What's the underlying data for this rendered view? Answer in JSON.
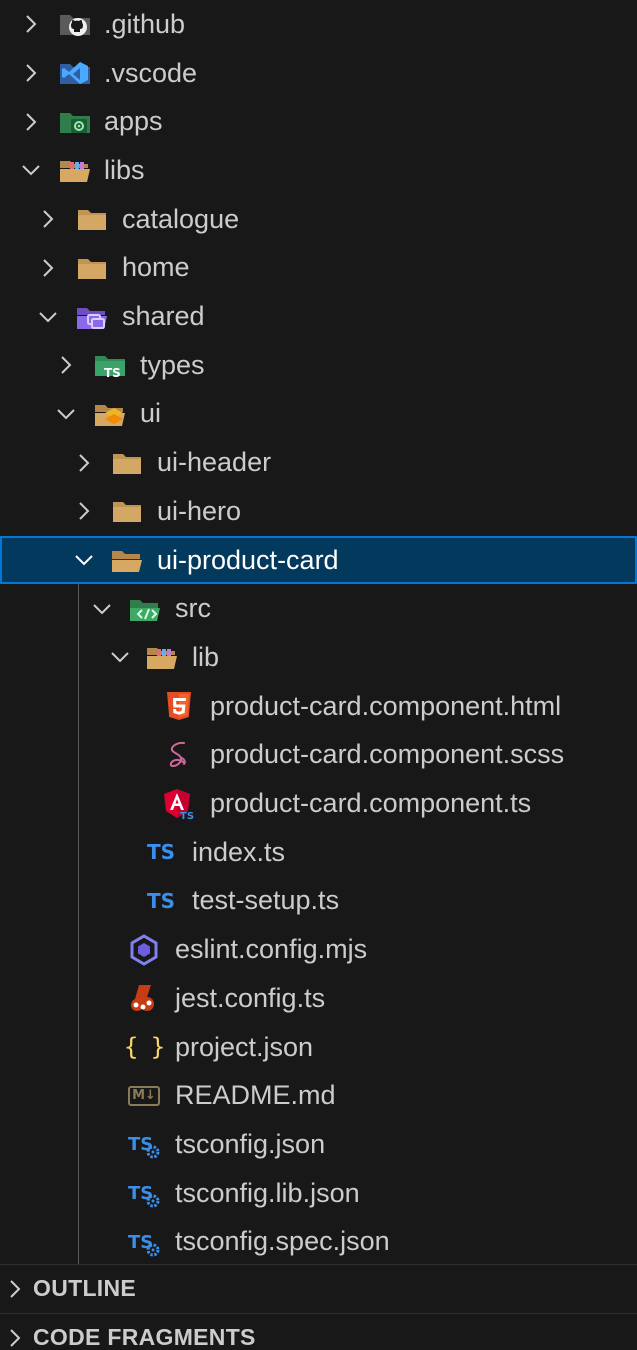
{
  "explorer": {
    "items": [
      {
        "label": ".github",
        "icon": "github-folder-icon",
        "expanded": false
      },
      {
        "label": ".vscode",
        "icon": "vscode-folder-icon",
        "expanded": false
      },
      {
        "label": "apps",
        "icon": "apps-folder-icon",
        "expanded": false
      },
      {
        "label": "libs",
        "icon": "libs-folder-open-icon",
        "expanded": true
      },
      {
        "label": "catalogue",
        "icon": "folder-icon",
        "expanded": false
      },
      {
        "label": "home",
        "icon": "folder-icon",
        "expanded": false
      },
      {
        "label": "shared",
        "icon": "shared-folder-open-icon",
        "expanded": true
      },
      {
        "label": "types",
        "icon": "typescript-folder-icon",
        "expanded": false
      },
      {
        "label": "ui",
        "icon": "ui-folder-open-icon",
        "expanded": true
      },
      {
        "label": "ui-header",
        "icon": "folder-icon",
        "expanded": false
      },
      {
        "label": "ui-hero",
        "icon": "folder-icon",
        "expanded": false
      },
      {
        "label": "ui-product-card",
        "icon": "folder-open-icon",
        "expanded": true,
        "selected": true
      },
      {
        "label": "src",
        "icon": "src-folder-open-icon",
        "expanded": true
      },
      {
        "label": "lib",
        "icon": "lib-folder-open-icon",
        "expanded": true
      },
      {
        "label": "product-card.component.html",
        "icon": "html5-icon"
      },
      {
        "label": "product-card.component.scss",
        "icon": "sass-icon"
      },
      {
        "label": "product-card.component.ts",
        "icon": "angular-ts-icon"
      },
      {
        "label": "index.ts",
        "icon": "typescript-icon"
      },
      {
        "label": "test-setup.ts",
        "icon": "typescript-icon"
      },
      {
        "label": "eslint.config.mjs",
        "icon": "eslint-icon"
      },
      {
        "label": "jest.config.ts",
        "icon": "jest-icon"
      },
      {
        "label": "project.json",
        "icon": "json-icon"
      },
      {
        "label": "README.md",
        "icon": "markdown-icon"
      },
      {
        "label": "tsconfig.json",
        "icon": "tsconfig-icon"
      },
      {
        "label": "tsconfig.lib.json",
        "icon": "tsconfig-icon"
      },
      {
        "label": "tsconfig.spec.json",
        "icon": "tsconfig-icon"
      }
    ],
    "ts_badge": "TS",
    "json_braces": "{ }",
    "md_badge": "M↓"
  },
  "sections": {
    "outline": "OUTLINE",
    "code_fragments": "CODE FRAGMENTS"
  },
  "colors": {
    "background": "#181818",
    "selection_bg": "#04395e",
    "selection_border": "#0078d4",
    "text": "#cccccc",
    "folder": "#c09553",
    "typescript": "#3b8eea"
  }
}
